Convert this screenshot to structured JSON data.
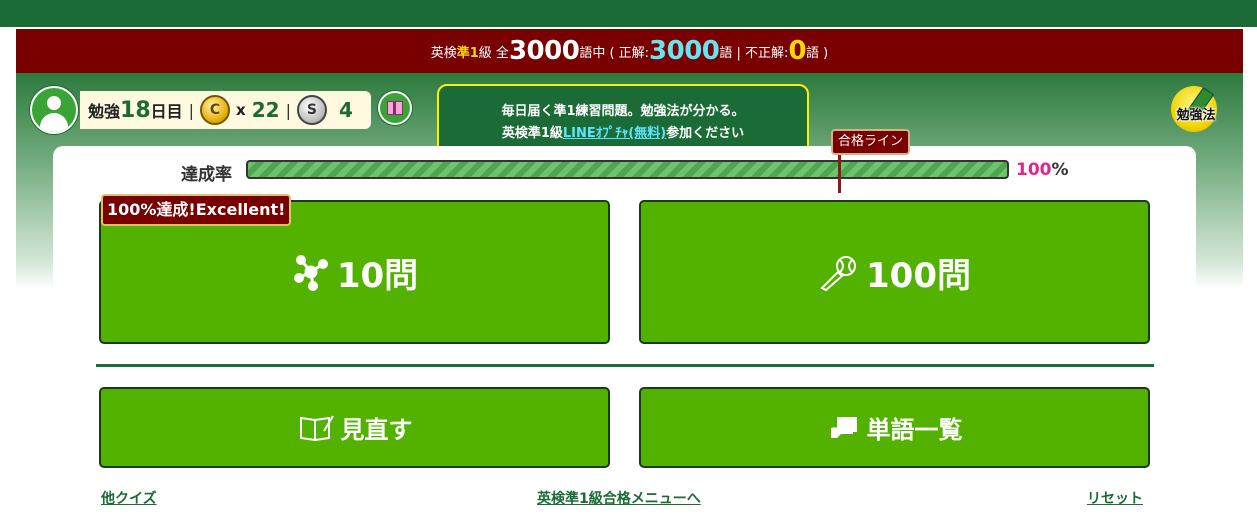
{
  "header": {
    "grade_prefix": "英検",
    "grade_level": "準1",
    "grade_suffix": "級 全",
    "total_words": "3000",
    "mid_text": "語中 ( 正解:",
    "correct": "3000",
    "after_correct": "語 | 不正解:",
    "incorrect": "0",
    "end_text": "語 )"
  },
  "status": {
    "days_prefix": "勉強",
    "days": "18",
    "days_suffix": "日目",
    "separator": "|",
    "gold_coin_letter": "C",
    "gold_multiplier": "x",
    "gold_count": "22",
    "silver_coin_letter": "S",
    "silver_count": "4"
  },
  "notice": {
    "line1": "毎日届く準1練習問題。勉強法が分かる。",
    "line2_prefix": "英検準1級",
    "line2_link": "LINEｵﾌﾟﾁｬ(無料)",
    "line2_suffix": "参加ください"
  },
  "study_method": {
    "label": "勉強法"
  },
  "progress": {
    "label": "達成率",
    "value": 100,
    "value_text": "100",
    "unit": "%",
    "pass_line_label": "合格ライン",
    "pass_line_position_pct": 78
  },
  "achievement_badge": "100%達成!Excellent!",
  "buttons": {
    "ten": "10問",
    "hundred": "100問",
    "review": "見直す",
    "word_list": "単語一覧"
  },
  "footer_links": {
    "other_quiz": "他クイズ",
    "menu": "英検準1級合格メニューへ",
    "reset": "リセット"
  },
  "colors": {
    "top_bar": "#1b6b36",
    "header_bar": "#780000",
    "button_green": "#53b200",
    "accent_cyan": "#66e4f0",
    "accent_yellow": "#ffd700",
    "percent_pink": "#e0268f"
  },
  "icons": {
    "avatar": "user-avatar-icon",
    "gold_coin": "gold-coin-icon",
    "silver_coin": "silver-coin-icon",
    "gift": "gift-icon",
    "study": "pencil-icon",
    "ten": "molecule-icon",
    "hundred": "baseball-bat-icon",
    "review": "open-book-icon",
    "word_list": "book-hand-icon"
  }
}
